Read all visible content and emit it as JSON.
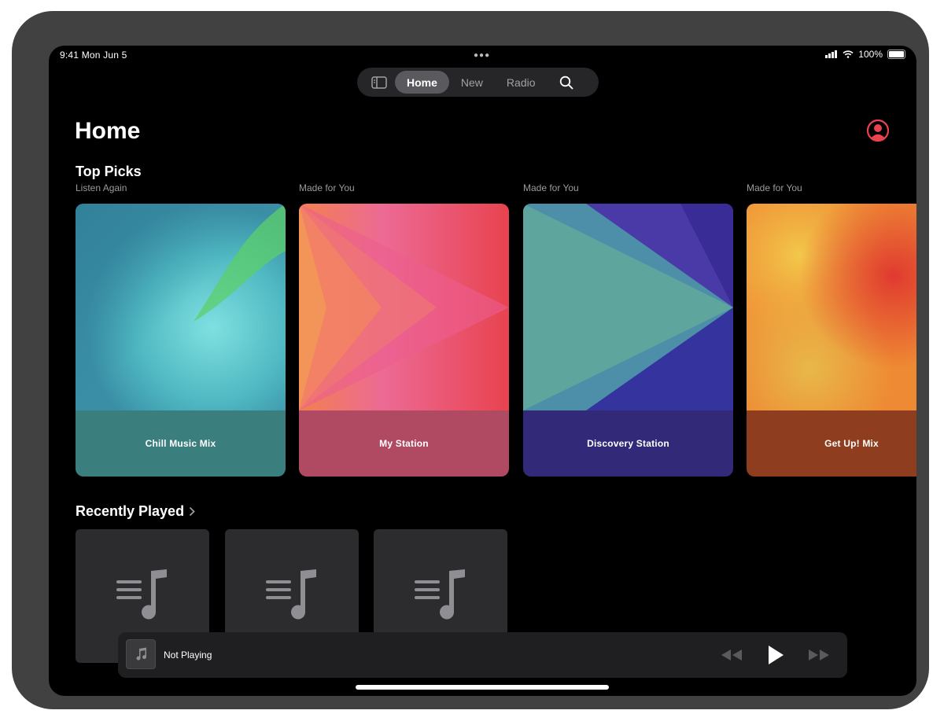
{
  "status_bar": {
    "time": "9:41  Mon Jun 5",
    "battery": "100%"
  },
  "tabbar": {
    "tabs": [
      {
        "label": "Home",
        "active": true
      },
      {
        "label": "New",
        "active": false
      },
      {
        "label": "Radio",
        "active": false
      }
    ]
  },
  "page": {
    "title": "Home",
    "accent_color": "#e8434f"
  },
  "top_picks": {
    "title": "Top Picks",
    "cards": [
      {
        "subtitle": "Listen Again",
        "label": "Chill Music Mix",
        "icon": "artwork-gradient-teal"
      },
      {
        "subtitle": "Made for You",
        "label": "My Station",
        "icon": "artwork-chevrons-pink"
      },
      {
        "subtitle": "Made for You",
        "label": "Discovery Station",
        "icon": "artwork-chevrons-blue"
      },
      {
        "subtitle": "Made for You",
        "label": "Get Up! Mix",
        "icon": "artwork-gradient-orange"
      }
    ]
  },
  "recently_played": {
    "title": "Recently Played",
    "tile_icon": "music-list-icon"
  },
  "mini_player": {
    "title": "Not Playing"
  }
}
